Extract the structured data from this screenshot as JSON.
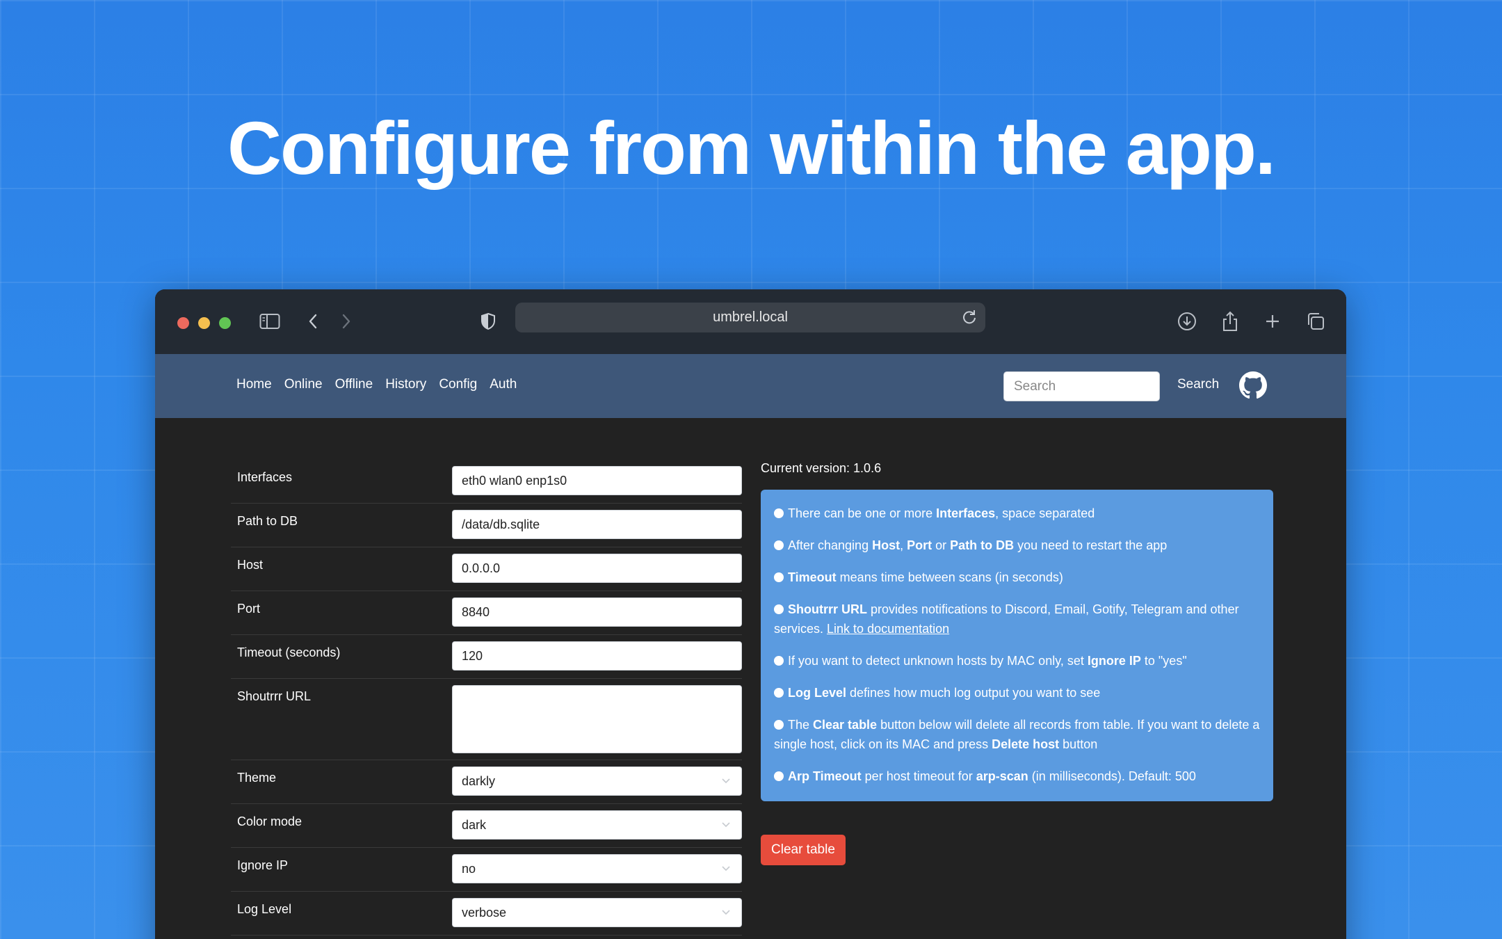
{
  "hero": {
    "title": "Configure from within the app."
  },
  "browser": {
    "url": "umbrel.local"
  },
  "nav": {
    "links": [
      "Home",
      "Online",
      "Offline",
      "History",
      "Config",
      "Auth"
    ],
    "search_placeholder": "Search",
    "search_button": "Search",
    "github_icon": "github-icon"
  },
  "form": {
    "rows": [
      {
        "label": "Interfaces",
        "value": "eth0 wlan0 enp1s0",
        "kind": "input"
      },
      {
        "label": "Path to DB",
        "value": "/data/db.sqlite",
        "kind": "input"
      },
      {
        "label": "Host",
        "value": "0.0.0.0",
        "kind": "input"
      },
      {
        "label": "Port",
        "value": "8840",
        "kind": "input"
      },
      {
        "label": "Timeout (seconds)",
        "value": "120",
        "kind": "input"
      },
      {
        "label": "Shoutrrr URL",
        "value": "",
        "kind": "textarea"
      },
      {
        "label": "Theme",
        "value": "darkly",
        "kind": "select"
      },
      {
        "label": "Color mode",
        "value": "dark",
        "kind": "select"
      },
      {
        "label": "Ignore IP",
        "value": "no",
        "kind": "select"
      },
      {
        "label": "Log Level",
        "value": "verbose",
        "kind": "select"
      }
    ]
  },
  "info": {
    "version": "Current version: 1.0.6",
    "items": [
      [
        {
          "t": "There can be one or more "
        },
        {
          "t": "Interfaces",
          "b": true
        },
        {
          "t": ", space separated"
        }
      ],
      [
        {
          "t": "After changing "
        },
        {
          "t": "Host",
          "b": true
        },
        {
          "t": ", "
        },
        {
          "t": "Port",
          "b": true
        },
        {
          "t": " or "
        },
        {
          "t": "Path to DB",
          "b": true
        },
        {
          "t": " you need to restart the app"
        }
      ],
      [
        {
          "t": "Timeout",
          "b": true
        },
        {
          "t": " means time between scans (in seconds)"
        }
      ],
      [
        {
          "t": "Shoutrrr URL",
          "b": true
        },
        {
          "t": " provides notifications to Discord, Email, Gotify, Telegram and other services. "
        },
        {
          "t": "Link to documentation",
          "u": true
        }
      ],
      [
        {
          "t": "If you want to detect unknown hosts by MAC only, set "
        },
        {
          "t": "Ignore IP",
          "b": true
        },
        {
          "t": " to \"yes\""
        }
      ],
      [
        {
          "t": "Log Level",
          "b": true
        },
        {
          "t": " defines how much log output you want to see"
        }
      ],
      [
        {
          "t": "The "
        },
        {
          "t": "Clear table",
          "b": true
        },
        {
          "t": " button below will delete all records from table. If you want to delete a single host, click on its MAC and press "
        },
        {
          "t": "Delete host",
          "b": true
        },
        {
          "t": " button"
        }
      ],
      [
        {
          "t": "Arp Timeout",
          "b": true
        },
        {
          "t": " per host timeout for "
        },
        {
          "t": "arp-scan",
          "b": true
        },
        {
          "t": " (in milliseconds). Default: 500"
        }
      ]
    ],
    "clear_button": "Clear table"
  },
  "colors": {
    "navbar": "#3e5779",
    "infobox": "#5b9be0",
    "danger": "#e74c3c",
    "traffic": [
      "#ed6a5e",
      "#f5bf4f",
      "#61c554"
    ]
  }
}
